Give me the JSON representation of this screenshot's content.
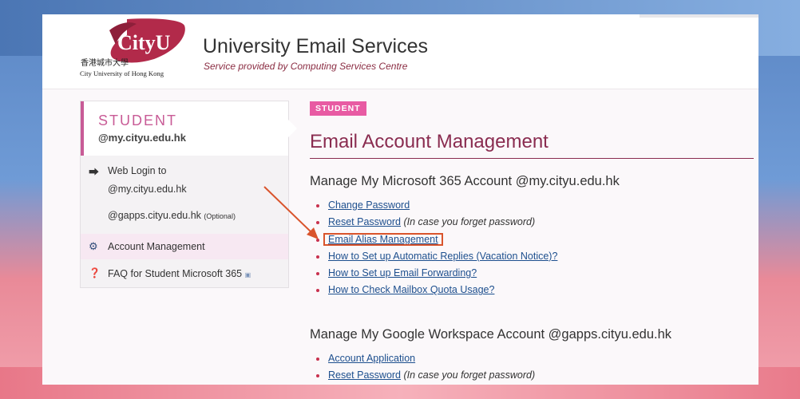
{
  "header": {
    "logo_text": "CityU",
    "logo_chinese": "香港城市大學",
    "logo_english": "City University of Hong Kong",
    "title": "University Email Services",
    "subtitle": "Service provided by Computing Services Centre"
  },
  "sidebar": {
    "heading": "STUDENT",
    "domain": "@my.cityu.edu.hk",
    "web_login_label": "Web Login to",
    "web_login_links": [
      {
        "label": "@my.cityu.edu.hk"
      },
      {
        "label": "@gapps.cityu.edu.hk",
        "note": "(Optional)"
      }
    ],
    "items": [
      {
        "label": "Account Management",
        "icon": "gears-icon",
        "active": true
      },
      {
        "label": "FAQ for Student Microsoft 365",
        "icon": "question-circle-icon",
        "active": false
      }
    ]
  },
  "main": {
    "badge": "STUDENT",
    "title": "Email Account Management",
    "sections": [
      {
        "title": "Manage My Microsoft 365 Account @my.cityu.edu.hk",
        "links": [
          {
            "label": "Change Password",
            "note": ""
          },
          {
            "label": "Reset Password",
            "note": "(In case you forget password)"
          },
          {
            "label": "Email Alias Management",
            "note": "",
            "highlighted": true
          },
          {
            "label": "How to Set up Automatic Replies (Vacation Notice)?",
            "note": ""
          },
          {
            "label": "How to Set up Email Forwarding?",
            "note": ""
          },
          {
            "label": "How to Check Mailbox Quota Usage?",
            "note": ""
          }
        ]
      },
      {
        "title": "Manage My Google Workspace Account @gapps.cityu.edu.hk",
        "links": [
          {
            "label": "Account Application",
            "note": ""
          },
          {
            "label": "Reset Password",
            "note": "(In case you forget password)"
          }
        ]
      }
    ]
  },
  "colors": {
    "accent": "#c85b96",
    "badge": "#e85ba3",
    "title": "#8a2c50",
    "link": "#1d4f8e",
    "highlight_box": "#d9542c"
  }
}
